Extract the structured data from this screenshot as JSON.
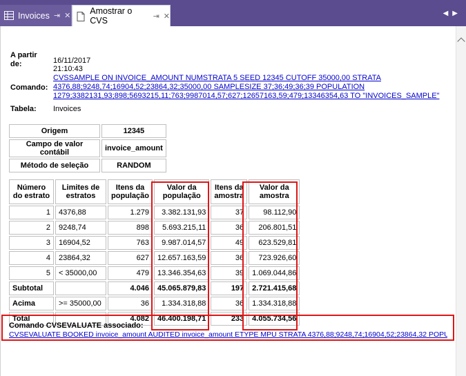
{
  "tabs": [
    {
      "label": "Invoices"
    },
    {
      "label": "Amostrar o CVS"
    }
  ],
  "meta": {
    "from_label": "A partir de:",
    "from_value": "16/11/2017 21:10:43",
    "command_label": "Comando:",
    "command_line1": "CVSSAMPLE ON INVOICE_AMOUNT NUMSTRATA 5 SEED 12345 CUTOFF 35000,00 STRATA",
    "command_line2": "4376,88;9248,74;16904,52;23864,32;35000,00 SAMPLESIZE 37;36;49;36;39 POPULATION",
    "command_line3": "1279;3382131,93;898;5693215,11;763;9987014,57;627;12657163,59;479;13346354,63 TO \"INVOICES_SAMPLE\"",
    "table_label": "Tabela:",
    "table_value": "Invoices"
  },
  "info_table": [
    {
      "label": "Origem",
      "value": "12345"
    },
    {
      "label": "Campo de valor contábil",
      "value": "invoice_amount"
    },
    {
      "label": "Método de seleção",
      "value": "RANDOM"
    }
  ],
  "strata_table": {
    "headers": [
      "Número do estrato",
      "Limites de estratos",
      "Itens da população",
      "Valor da população",
      "Itens da amostra",
      "Valor da amostra"
    ],
    "rows": [
      {
        "n": "1",
        "limit": "4376,88",
        "pop_items": "1.279",
        "pop_value": "3.382.131,93",
        "sample_items": "37",
        "sample_value": "98.112,90"
      },
      {
        "n": "2",
        "limit": "9248,74",
        "pop_items": "898",
        "pop_value": "5.693.215,11",
        "sample_items": "36",
        "sample_value": "206.801,51"
      },
      {
        "n": "3",
        "limit": "16904,52",
        "pop_items": "763",
        "pop_value": "9.987.014,57",
        "sample_items": "49",
        "sample_value": "623.529,81"
      },
      {
        "n": "4",
        "limit": "23864,32",
        "pop_items": "627",
        "pop_value": "12.657.163,59",
        "sample_items": "36",
        "sample_value": "723.926,60"
      },
      {
        "n": "5",
        "limit": "< 35000,00",
        "pop_items": "479",
        "pop_value": "13.346.354,63",
        "sample_items": "39",
        "sample_value": "1.069.044,86"
      }
    ],
    "subtotal": {
      "label": "Subtotal",
      "limit": "",
      "pop_items": "4.046",
      "pop_value": "45.065.879,83",
      "sample_items": "197",
      "sample_value": "2.721.415,68"
    },
    "above": {
      "label": "Acima",
      "limit": ">= 35000,00",
      "pop_items": "36",
      "pop_value": "1.334.318,88",
      "sample_items": "36",
      "sample_value": "1.334.318,88"
    },
    "total": {
      "label": "Total",
      "limit": "",
      "pop_items": "4.082",
      "pop_value": "46.400.198,71",
      "sample_items": "233",
      "sample_value": "4.055.734,56"
    }
  },
  "associated": {
    "label": "Comando CVSEVALUATE associado:",
    "command": "CVSEVALUATE BOOKED invoice_amount AUDITED invoice_amount ETYPE MPU STRATA 4376,88;9248,74;16904,52;23864,32 POPU..."
  },
  "colors": {
    "tabbar": "#5b4c8f",
    "highlight": "#e01515",
    "link": "#0000cc"
  }
}
